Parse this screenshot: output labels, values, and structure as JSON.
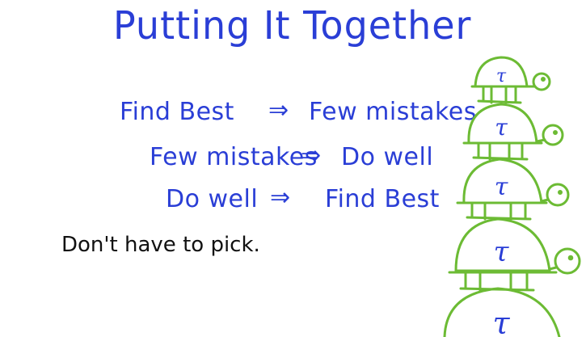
{
  "title": "Putting It Together",
  "rows": [
    {
      "left": "Find Best",
      "arrow": "⇒",
      "right": "Few mistakes"
    },
    {
      "left": "Few mistakes",
      "arrow": "⇒",
      "right": "Do well"
    },
    {
      "left": "Do well",
      "arrow": "⇒",
      "right": "Find Best"
    }
  ],
  "note": "Don't have to pick.",
  "turtle_shell_letter": "τ",
  "colors": {
    "ink_blue": "#2a3ed6",
    "ink_black": "#111111",
    "turtle_green": "#6cbb34"
  }
}
